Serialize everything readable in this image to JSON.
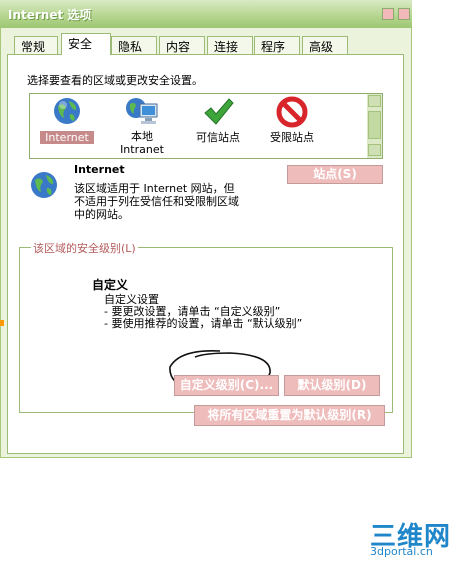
{
  "window": {
    "title": "Internet 选项"
  },
  "tabs": [
    "常规",
    "安全",
    "隐私",
    "内容",
    "连接",
    "程序",
    "高级"
  ],
  "active_tab": "安全",
  "instruction": "选择要查看的区域或更改安全设置。",
  "zones": [
    {
      "label": "Internet",
      "icon": "globe-icon"
    },
    {
      "label": "本地\nIntranet",
      "icon": "intranet-icon"
    },
    {
      "label": "可信站点",
      "icon": "checkmark-icon"
    },
    {
      "label": "受限站点",
      "icon": "forbidden-icon"
    }
  ],
  "selected_zone": {
    "name": "Internet",
    "description": "该区域适用于 Internet 网站，但\n不适用于列在受信任和受限制区域\n中的网站。",
    "sites_button": "站点(S)"
  },
  "security_level": {
    "group_title": "该区域的安全级别(L)",
    "level_name": "自定义",
    "lines": [
      "自定义设置",
      "- 要更改设置，请单击 “自定义级别”",
      "- 要使用推荐的设置，请单击 “默认级别”"
    ],
    "custom_button": "自定义级别(C)...",
    "default_button": "默认级别(D)",
    "reset_all_button": "将所有区域重置为默认级别(R)"
  },
  "watermark": {
    "brand": "三维网",
    "url": "3dportal.cn"
  },
  "colors": {
    "accent_green": "#9dc773",
    "button_pink": "#efbcbc",
    "selected_zone_bg": "#c78a8a"
  }
}
